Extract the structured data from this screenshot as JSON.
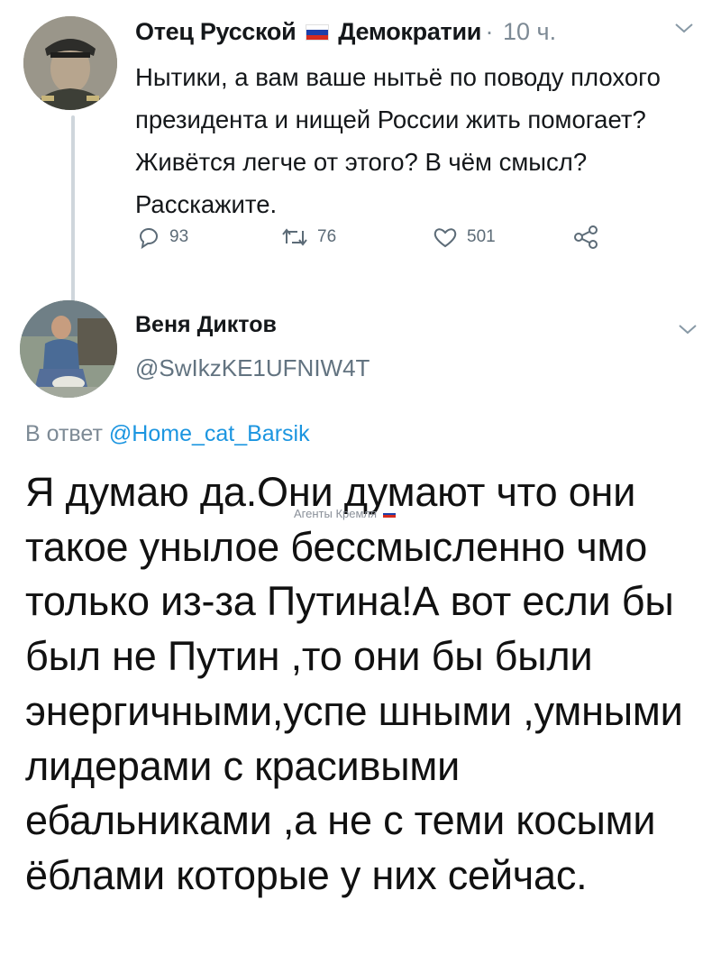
{
  "tweet1": {
    "author_prefix": "Отец Русской",
    "author_suffix": "Демократии",
    "separator": "·",
    "time": "10 ч.",
    "text": "Нытики, а вам ваше нытьё по поводу плохого президента и нищей России жить помогает? Живётся легче от этого? В чём смысл? Расскажите.",
    "replies": "93",
    "retweets": "76",
    "likes": "501",
    "flag_colors": [
      "#ffffff",
      "#1c3faa",
      "#d52b1e"
    ]
  },
  "tweet2": {
    "author": "Веня Диктов",
    "handle": "@SwIkzKE1UFNIW4T",
    "reply_prefix": "В ответ",
    "reply_user": "@Home_cat_Barsik",
    "text": "Я думаю да.Они думают что они такое унылое бессмысленно чмо только из-за Путина!А вот если бы был не Путин ,то они бы были энергичными,успе шными ,умными лидерами с красивыми ебальниками ,а не с теми косыми ёблами которые у них сейчас."
  },
  "watermark": {
    "text": "Агенты Кремля"
  },
  "icons": {
    "reply": "reply-icon",
    "retweet": "retweet-icon",
    "like": "heart-icon",
    "share": "share-icon",
    "menu": "chevron-down-icon"
  },
  "colors": {
    "link": "#1b95e0",
    "secondary_text": "#7d8a95",
    "thread_line": "#cfd6dc"
  }
}
